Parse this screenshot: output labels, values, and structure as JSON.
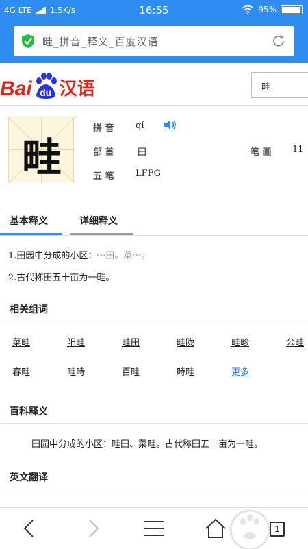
{
  "statusbar": {
    "network": "4G LTE",
    "speed": "1.5K/s",
    "time": "16:55",
    "battery": "95%"
  },
  "urlbar": {
    "title": "畦_拼音_释义_百度汉语"
  },
  "header": {
    "logo_bai": "Bai",
    "logo_du": "du",
    "logo_han": "汉语",
    "search_value": "畦"
  },
  "character": {
    "glyph": "畦"
  },
  "info": {
    "pinyin_label": "拼 音",
    "pinyin": "qí",
    "radical_label": "部 首",
    "radical": "田",
    "strokes_label": "笔 画",
    "strokes": "11",
    "wubi_label": "五 笔",
    "wubi": "LFFG"
  },
  "tabs": {
    "basic": "基本释义",
    "detail": "详细释义"
  },
  "definitions": {
    "d1_main": "1.田园中分成的小区：",
    "d1_examples": "～田。菜～。",
    "d2": "2.古代称田五十亩为一畦。"
  },
  "related": {
    "title": "相关组词",
    "words": [
      "菜畦",
      "阳畦",
      "畦田",
      "畦陇",
      "畦畛",
      "公畦",
      "春畦",
      "畦畤",
      "百畦",
      "畤畦"
    ],
    "more": "更多"
  },
  "baike": {
    "title": "百科释义",
    "text": "田园中分成的小区：畦田、菜畦。古代称田五十亩为一畦。"
  },
  "english": {
    "title": "英文翻译"
  },
  "nav": {
    "tab_count": "1"
  },
  "colors": {
    "accent": "#2f8cf0",
    "logo_red": "#e1251b",
    "logo_blue": "#2932e1"
  }
}
